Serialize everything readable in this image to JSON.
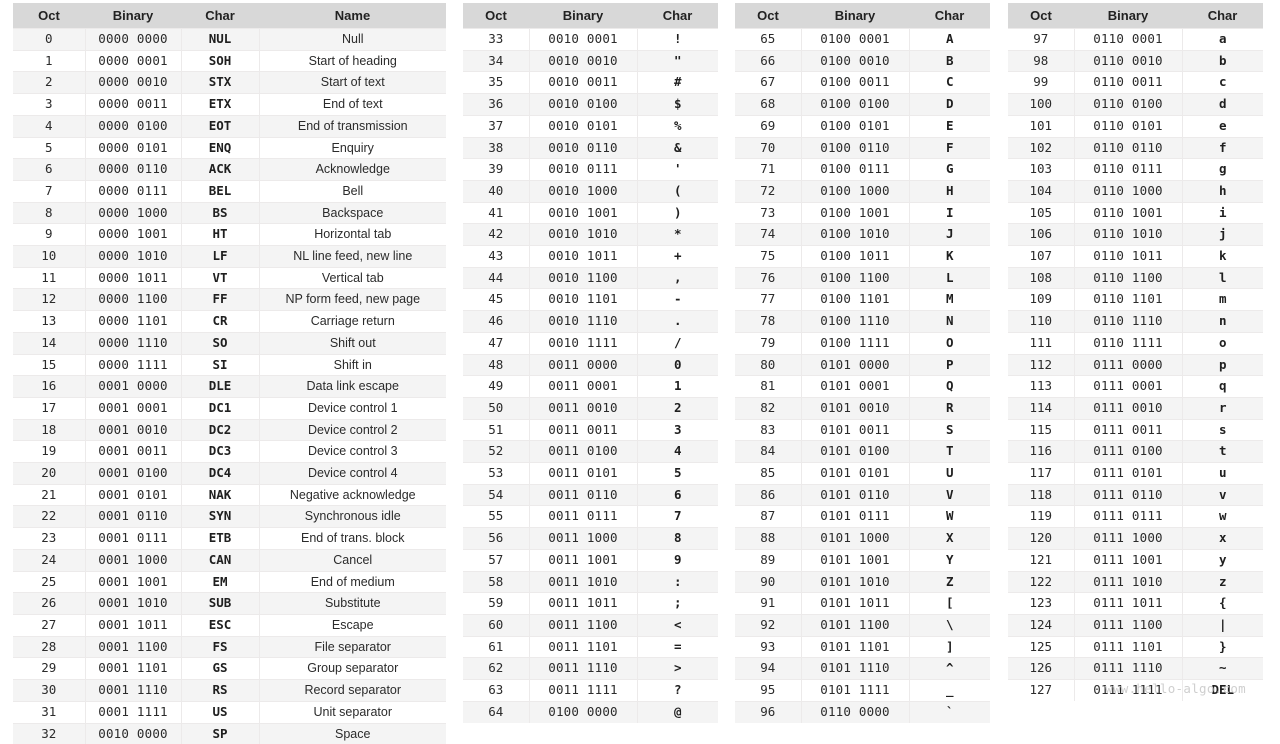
{
  "watermark": "www.hello-algo.com",
  "tables": [
    {
      "id": "control-characters",
      "headers": [
        "Oct",
        "Binary",
        "Char",
        "Name"
      ],
      "has_name_column": true,
      "start_shaded": true,
      "rows": [
        [
          "0",
          "0000 0000",
          "NUL",
          "Null"
        ],
        [
          "1",
          "0000 0001",
          "SOH",
          "Start of heading"
        ],
        [
          "2",
          "0000 0010",
          "STX",
          "Start of text"
        ],
        [
          "3",
          "0000 0011",
          "ETX",
          "End of text"
        ],
        [
          "4",
          "0000 0100",
          "EOT",
          "End of transmission"
        ],
        [
          "5",
          "0000 0101",
          "ENQ",
          "Enquiry"
        ],
        [
          "6",
          "0000 0110",
          "ACK",
          "Acknowledge"
        ],
        [
          "7",
          "0000 0111",
          "BEL",
          "Bell"
        ],
        [
          "8",
          "0000 1000",
          "BS",
          "Backspace"
        ],
        [
          "9",
          "0000 1001",
          "HT",
          "Horizontal tab"
        ],
        [
          "10",
          "0000 1010",
          "LF",
          "NL line feed, new line"
        ],
        [
          "11",
          "0000 1011",
          "VT",
          "Vertical tab"
        ],
        [
          "12",
          "0000 1100",
          "FF",
          "NP form feed, new page"
        ],
        [
          "13",
          "0000 1101",
          "CR",
          "Carriage return"
        ],
        [
          "14",
          "0000 1110",
          "SO",
          "Shift out"
        ],
        [
          "15",
          "0000 1111",
          "SI",
          "Shift in"
        ],
        [
          "16",
          "0001 0000",
          "DLE",
          "Data link escape"
        ],
        [
          "17",
          "0001 0001",
          "DC1",
          "Device control 1"
        ],
        [
          "18",
          "0001 0010",
          "DC2",
          "Device control 2"
        ],
        [
          "19",
          "0001 0011",
          "DC3",
          "Device control 3"
        ],
        [
          "20",
          "0001 0100",
          "DC4",
          "Device control 4"
        ],
        [
          "21",
          "0001 0101",
          "NAK",
          "Negative acknowledge"
        ],
        [
          "22",
          "0001 0110",
          "SYN",
          "Synchronous idle"
        ],
        [
          "23",
          "0001 0111",
          "ETB",
          "End of trans. block"
        ],
        [
          "24",
          "0001 1000",
          "CAN",
          "Cancel"
        ],
        [
          "25",
          "0001 1001",
          "EM",
          "End of medium"
        ],
        [
          "26",
          "0001 1010",
          "SUB",
          "Substitute"
        ],
        [
          "27",
          "0001 1011",
          "ESC",
          "Escape"
        ],
        [
          "28",
          "0001 1100",
          "FS",
          "File separator"
        ],
        [
          "29",
          "0001 1101",
          "GS",
          "Group separator"
        ],
        [
          "30",
          "0001 1110",
          "RS",
          "Record separator"
        ],
        [
          "31",
          "0001 1111",
          "US",
          "Unit separator"
        ],
        [
          "32",
          "0010 0000",
          "SP",
          "Space"
        ]
      ]
    },
    {
      "id": "punctuation-digits",
      "headers": [
        "Oct",
        "Binary",
        "Char"
      ],
      "has_name_column": false,
      "start_shaded": false,
      "rows": [
        [
          "33",
          "0010 0001",
          "!"
        ],
        [
          "34",
          "0010 0010",
          "\""
        ],
        [
          "35",
          "0010 0011",
          "#"
        ],
        [
          "36",
          "0010 0100",
          "$"
        ],
        [
          "37",
          "0010 0101",
          "%"
        ],
        [
          "38",
          "0010 0110",
          "&"
        ],
        [
          "39",
          "0010 0111",
          "'"
        ],
        [
          "40",
          "0010 1000",
          "("
        ],
        [
          "41",
          "0010 1001",
          ")"
        ],
        [
          "42",
          "0010 1010",
          "*"
        ],
        [
          "43",
          "0010 1011",
          "+"
        ],
        [
          "44",
          "0010 1100",
          ","
        ],
        [
          "45",
          "0010 1101",
          "-"
        ],
        [
          "46",
          "0010 1110",
          "."
        ],
        [
          "47",
          "0010 1111",
          "/"
        ],
        [
          "48",
          "0011 0000",
          "0"
        ],
        [
          "49",
          "0011 0001",
          "1"
        ],
        [
          "50",
          "0011 0010",
          "2"
        ],
        [
          "51",
          "0011 0011",
          "3"
        ],
        [
          "52",
          "0011 0100",
          "4"
        ],
        [
          "53",
          "0011 0101",
          "5"
        ],
        [
          "54",
          "0011 0110",
          "6"
        ],
        [
          "55",
          "0011 0111",
          "7"
        ],
        [
          "56",
          "0011 1000",
          "8"
        ],
        [
          "57",
          "0011 1001",
          "9"
        ],
        [
          "58",
          "0011 1010",
          ":"
        ],
        [
          "59",
          "0011 1011",
          ";"
        ],
        [
          "60",
          "0011 1100",
          "<"
        ],
        [
          "61",
          "0011 1101",
          "="
        ],
        [
          "62",
          "0011 1110",
          ">"
        ],
        [
          "63",
          "0011 1111",
          "?"
        ],
        [
          "64",
          "0100 0000",
          "@"
        ]
      ]
    },
    {
      "id": "uppercase-letters",
      "headers": [
        "Oct",
        "Binary",
        "Char"
      ],
      "has_name_column": false,
      "start_shaded": false,
      "rows": [
        [
          "65",
          "0100 0001",
          "A"
        ],
        [
          "66",
          "0100 0010",
          "B"
        ],
        [
          "67",
          "0100 0011",
          "C"
        ],
        [
          "68",
          "0100 0100",
          "D"
        ],
        [
          "69",
          "0100 0101",
          "E"
        ],
        [
          "70",
          "0100 0110",
          "F"
        ],
        [
          "71",
          "0100 0111",
          "G"
        ],
        [
          "72",
          "0100 1000",
          "H"
        ],
        [
          "73",
          "0100 1001",
          "I"
        ],
        [
          "74",
          "0100 1010",
          "J"
        ],
        [
          "75",
          "0100 1011",
          "K"
        ],
        [
          "76",
          "0100 1100",
          "L"
        ],
        [
          "77",
          "0100 1101",
          "M"
        ],
        [
          "78",
          "0100 1110",
          "N"
        ],
        [
          "79",
          "0100 1111",
          "O"
        ],
        [
          "80",
          "0101 0000",
          "P"
        ],
        [
          "81",
          "0101 0001",
          "Q"
        ],
        [
          "82",
          "0101 0010",
          "R"
        ],
        [
          "83",
          "0101 0011",
          "S"
        ],
        [
          "84",
          "0101 0100",
          "T"
        ],
        [
          "85",
          "0101 0101",
          "U"
        ],
        [
          "86",
          "0101 0110",
          "V"
        ],
        [
          "87",
          "0101 0111",
          "W"
        ],
        [
          "88",
          "0101 1000",
          "X"
        ],
        [
          "89",
          "0101 1001",
          "Y"
        ],
        [
          "90",
          "0101 1010",
          "Z"
        ],
        [
          "91",
          "0101 1011",
          "["
        ],
        [
          "92",
          "0101 1100",
          "\\"
        ],
        [
          "93",
          "0101 1101",
          "]"
        ],
        [
          "94",
          "0101 1110",
          "^"
        ],
        [
          "95",
          "0101 1111",
          "_"
        ],
        [
          "96",
          "0110 0000",
          "`"
        ]
      ]
    },
    {
      "id": "lowercase-letters",
      "headers": [
        "Oct",
        "Binary",
        "Char"
      ],
      "has_name_column": false,
      "start_shaded": false,
      "rows": [
        [
          "97",
          "0110 0001",
          "a"
        ],
        [
          "98",
          "0110 0010",
          "b"
        ],
        [
          "99",
          "0110 0011",
          "c"
        ],
        [
          "100",
          "0110 0100",
          "d"
        ],
        [
          "101",
          "0110 0101",
          "e"
        ],
        [
          "102",
          "0110 0110",
          "f"
        ],
        [
          "103",
          "0110 0111",
          "g"
        ],
        [
          "104",
          "0110 1000",
          "h"
        ],
        [
          "105",
          "0110 1001",
          "i"
        ],
        [
          "106",
          "0110 1010",
          "j"
        ],
        [
          "107",
          "0110 1011",
          "k"
        ],
        [
          "108",
          "0110 1100",
          "l"
        ],
        [
          "109",
          "0110 1101",
          "m"
        ],
        [
          "110",
          "0110 1110",
          "n"
        ],
        [
          "111",
          "0110 1111",
          "o"
        ],
        [
          "112",
          "0111 0000",
          "p"
        ],
        [
          "113",
          "0111 0001",
          "q"
        ],
        [
          "114",
          "0111 0010",
          "r"
        ],
        [
          "115",
          "0111 0011",
          "s"
        ],
        [
          "116",
          "0111 0100",
          "t"
        ],
        [
          "117",
          "0111 0101",
          "u"
        ],
        [
          "118",
          "0111 0110",
          "v"
        ],
        [
          "119",
          "0111 0111",
          "w"
        ],
        [
          "120",
          "0111 1000",
          "x"
        ],
        [
          "121",
          "0111 1001",
          "y"
        ],
        [
          "122",
          "0111 1010",
          "z"
        ],
        [
          "123",
          "0111 1011",
          "{"
        ],
        [
          "124",
          "0111 1100",
          "|"
        ],
        [
          "125",
          "0111 1101",
          "}"
        ],
        [
          "126",
          "0111 1110",
          "~"
        ],
        [
          "127",
          "0111 1111",
          "DEL"
        ]
      ]
    }
  ]
}
